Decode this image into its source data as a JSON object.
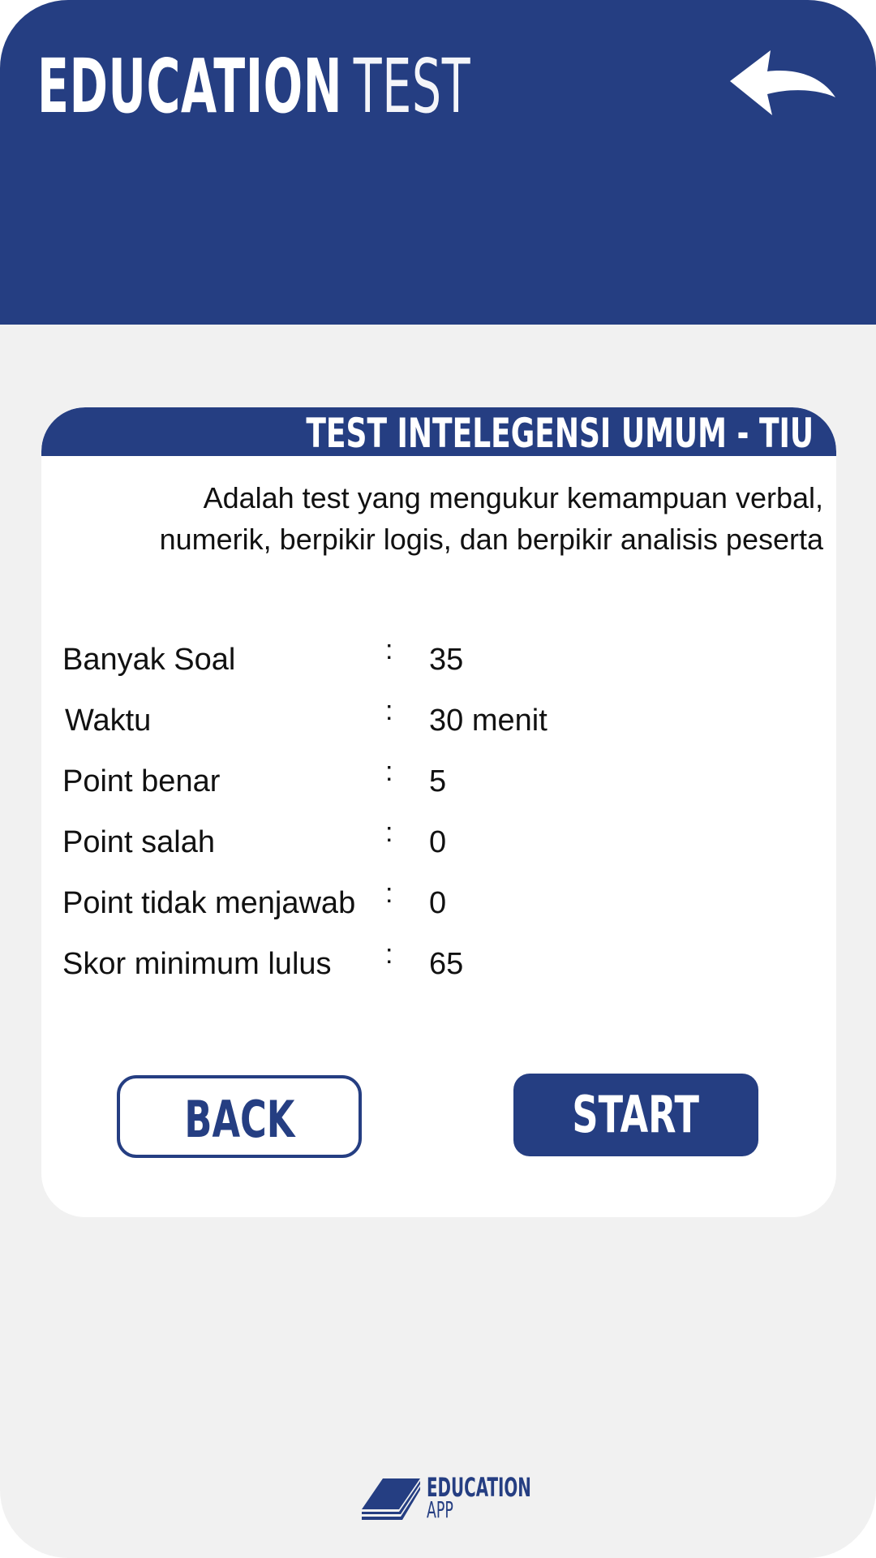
{
  "header": {
    "title_bold": "EDUCATION",
    "title_thin": "TEST",
    "back_icon": "curved-back-arrow-icon"
  },
  "card": {
    "title": "TEST INTELEGENSI UMUM - TIU",
    "description": "Adalah test yang mengukur kemampuan verbal,\nnumerik, berpikir logis, dan berpikir analisis peserta",
    "separator": ":",
    "rows": [
      {
        "label": "Banyak Soal",
        "value": "35"
      },
      {
        "label": "Waktu",
        "value": "30 menit"
      },
      {
        "label": "Point benar",
        "value": "5"
      },
      {
        "label": "Point salah",
        "value": "0"
      },
      {
        "label": "Point tidak menjawab",
        "value": "0"
      },
      {
        "label": "Skor minimum lulus",
        "value": "65"
      }
    ],
    "back_label": "BACK",
    "start_label": "START"
  },
  "footer": {
    "logo_line1": "EDUCATION",
    "logo_line2": "APP",
    "logo_icon": "book-icon"
  },
  "colors": {
    "primary": "#253e82",
    "background": "#f1f1f1",
    "card": "#ffffff"
  }
}
